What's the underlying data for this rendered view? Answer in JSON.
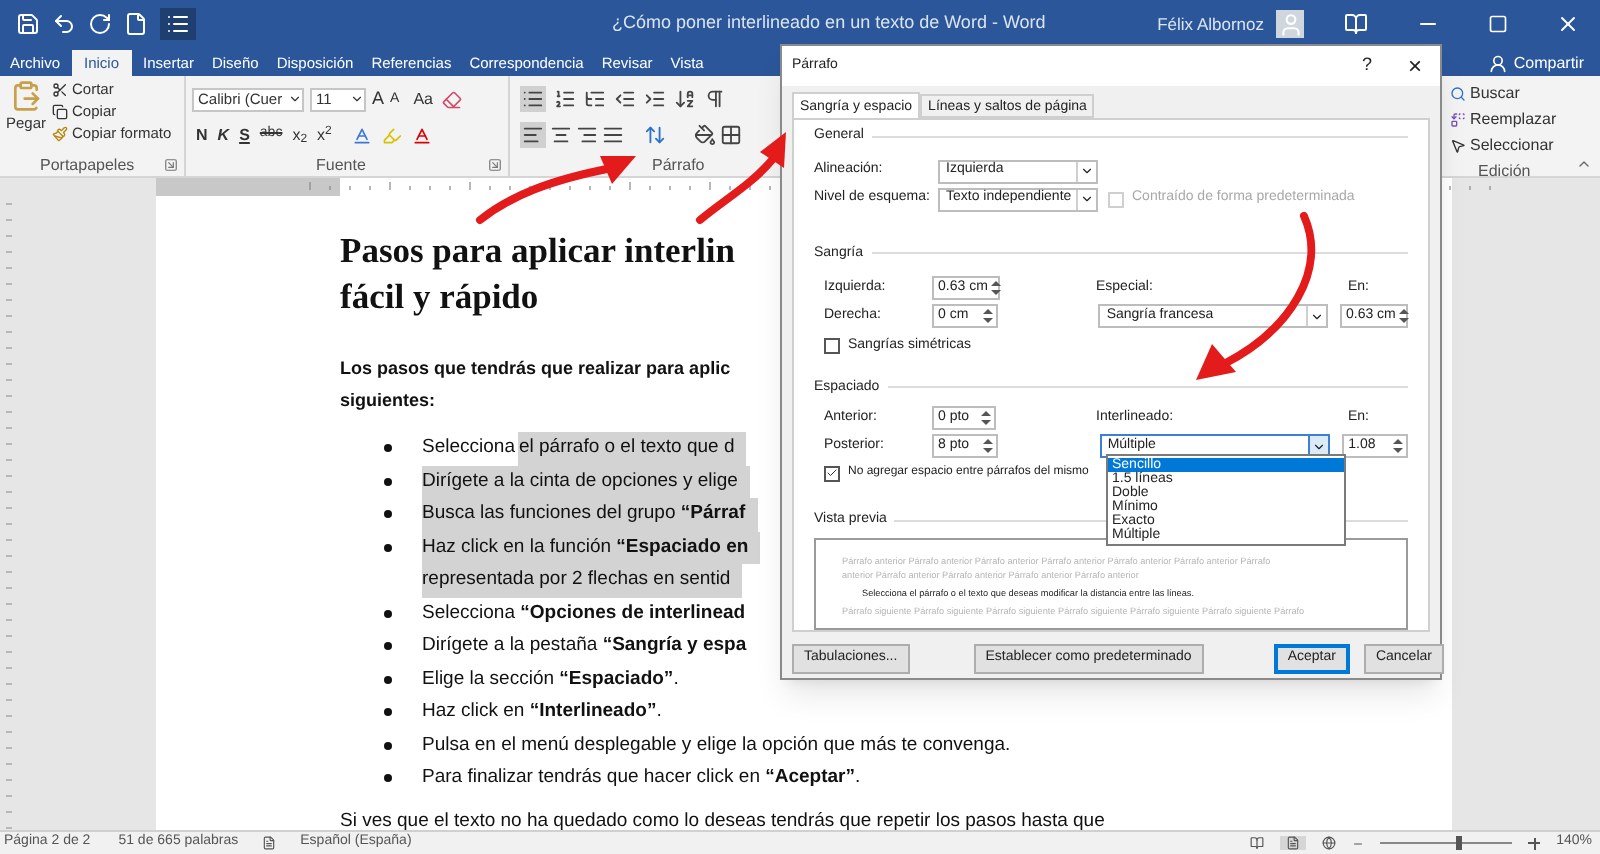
{
  "window": {
    "title": "¿Cómo poner interlineado en un texto de Word  -  Word",
    "user": "Félix Albornoz"
  },
  "tabs": [
    {
      "label": "Archivo",
      "selected": false
    },
    {
      "label": "Inicio",
      "selected": true
    },
    {
      "label": "Insertar",
      "selected": false
    },
    {
      "label": "Diseño",
      "selected": false
    },
    {
      "label": "Disposición",
      "selected": false
    },
    {
      "label": "Referencias",
      "selected": false
    },
    {
      "label": "Correspondencia",
      "selected": false
    },
    {
      "label": "Revisar",
      "selected": false
    },
    {
      "label": "Vista",
      "selected": false
    }
  ],
  "share_button": "Compartir",
  "ribbon": {
    "clipboard": {
      "paste": "Pegar",
      "items": [
        "Cortar",
        "Copiar",
        "Copiar formato"
      ],
      "label": "Portapapeles"
    },
    "font": {
      "font_name": "Calibri (Cuer",
      "font_size": "11",
      "size_buttons": [
        "A",
        "A"
      ],
      "case_button": "Aa",
      "format_buttons": [
        "N",
        "K",
        "S",
        "abc",
        "x$_{2}$",
        "x$^{2}$"
      ],
      "label": "Fuente"
    },
    "paragraph": {
      "label": "Párrafo"
    },
    "editing": {
      "items": [
        "Buscar",
        "Reemplazar",
        "Seleccionar"
      ],
      "label": "Edición"
    }
  },
  "document": {
    "heading": [
      "Pasos para aplicar interlin",
      "fácil y rápido"
    ],
    "intro": [
      "Los pasos que tendrás que realizar para aplic",
      "siguientes:"
    ],
    "bullets": [
      {
        "lead": "Selecciona",
        "lines": [
          "el párrafo o el texto que d"
        ],
        "selected": true
      },
      {
        "lines": [
          "Dirígete a la cinta de opciones y elige"
        ],
        "selected": true
      },
      {
        "lines": [
          "Busca las funciones del grupo **“Párraf**"
        ],
        "selected": true
      },
      {
        "lines": [
          "Haz click en la función **“Espaciado en**",
          "representada por 2 flechas en sentid"
        ],
        "selected": true
      },
      {
        "lines": [
          "Selecciona **“Opciones de interlinead**"
        ],
        "selected": false
      },
      {
        "lines": [
          "Dirígete a la pestaña **“Sangría y espa**"
        ],
        "selected": false
      },
      {
        "lines": [
          "Elige la sección **“Espaciado”**."
        ],
        "selected": false
      },
      {
        "lines": [
          "Haz click en **“Interlineado”**."
        ],
        "selected": false
      },
      {
        "lines": [
          "Pulsa en el menú desplegable y elige la opción que más te convenga."
        ],
        "selected": false
      },
      {
        "lines": [
          "Para finalizar tendrás que hacer click en **“Aceptar”**."
        ],
        "selected": false
      }
    ],
    "closing": "Si ves que el texto no ha quedado como lo deseas tendrás que repetir los pasos hasta que"
  },
  "dialog": {
    "title": "Párrafo",
    "help": "?",
    "close": "×",
    "tabs": [
      {
        "label": "Sangría y espacio",
        "selected": true
      },
      {
        "label": "Líneas y saltos de página",
        "selected": false
      }
    ],
    "general": {
      "heading": "General",
      "alignment": {
        "label": "Alineación:",
        "value": "Izquierda"
      },
      "outline": {
        "label": "Nivel de esquema:",
        "value": "Texto independiente"
      },
      "collapsed": {
        "label": "Contraído de forma predeterminada",
        "checked": false,
        "disabled": true
      }
    },
    "indent": {
      "heading": "Sangría",
      "left": {
        "label": "Izquierda:",
        "value": "0.63 cm"
      },
      "right": {
        "label": "Derecha:",
        "value": "0 cm"
      },
      "special": {
        "label": "Especial:",
        "value": "Sangría francesa"
      },
      "by": {
        "label": "En:",
        "value": "0.63 cm"
      },
      "mirror": {
        "label": "Sangrías simétricas",
        "checked": false
      }
    },
    "spacing": {
      "heading": "Espaciado",
      "before": {
        "label": "Anterior:",
        "value": "0 pto"
      },
      "after": {
        "label": "Posterior:",
        "value": "8 pto"
      },
      "line_spacing": {
        "label": "Interlineado:",
        "value": "Múltiple",
        "expanded": true
      },
      "at": {
        "label": "En:",
        "value": "1.08"
      },
      "no_space": {
        "label": "No agregar espacio entre párrafos del mismo",
        "checked": true
      }
    },
    "line_spacing_options": [
      {
        "label": "Sencillo",
        "selected": true
      },
      {
        "label": "1.5 líneas",
        "selected": false
      },
      {
        "label": "Doble",
        "selected": false
      },
      {
        "label": "Mínimo",
        "selected": false
      },
      {
        "label": "Exacto",
        "selected": false
      },
      {
        "label": "Múltiple",
        "selected": false
      }
    ],
    "preview": {
      "heading": "Vista previa",
      "before_lines": [
        "Párrafo anterior Párrafo anterior Párrafo anterior Párrafo anterior Párrafo anterior Párrafo anterior Párrafo",
        "anterior Párrafo anterior Párrafo anterior Párrafo anterior Párrafo anterior"
      ],
      "sample": "Selecciona el párrafo o el texto que deseas modificar la distancia entre las líneas.",
      "after_lines": [
        "Párrafo siguiente Párrafo siguiente Párrafo siguiente Párrafo siguiente Párrafo siguiente Párrafo siguiente Párrafo"
      ]
    },
    "buttons": [
      {
        "label": "Tabulaciones...",
        "default": false
      },
      {
        "label": "Establecer como predeterminado",
        "default": false
      },
      {
        "label": "Aceptar",
        "default": true
      },
      {
        "label": "Cancelar",
        "default": false
      }
    ]
  },
  "status_bar": {
    "page": "Página 2 de 2",
    "words": "51 de 665 palabras",
    "language": "Español (España)",
    "zoom": {
      "level": 0.6,
      "reading": "140%"
    }
  }
}
